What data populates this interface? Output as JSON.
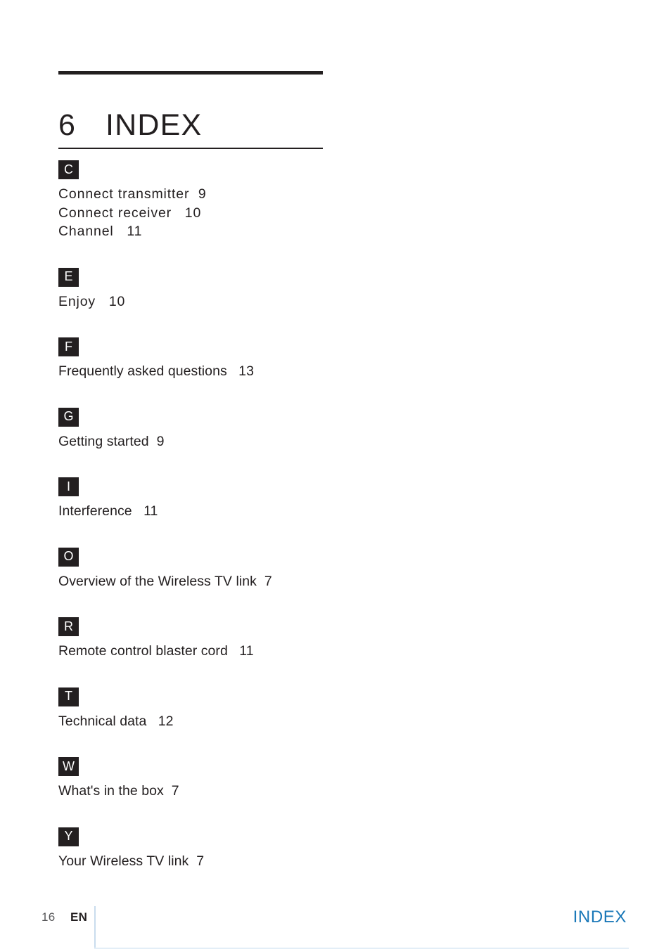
{
  "page": {
    "background_color": "#ffffff",
    "text_color": "#231f20"
  },
  "header": {
    "chapter_number": "6",
    "chapter_title": "INDEX"
  },
  "index": {
    "sections": [
      {
        "letter": "C",
        "entries": [
          {
            "term": "Connect transmitter",
            "page": "9",
            "text": "Connect transmitter  9"
          },
          {
            "term": "Connect receiver",
            "page": "10",
            "text": "Connect receiver   10"
          },
          {
            "term": "Channel",
            "page": "11",
            "text": "Channel   11"
          }
        ]
      },
      {
        "letter": "E",
        "entries": [
          {
            "term": "Enjoy",
            "page": "10",
            "text": "Enjoy   10"
          }
        ]
      },
      {
        "letter": "F",
        "entries": [
          {
            "term": "Frequently asked questions",
            "page": "13",
            "text": "Frequently asked questions   13"
          }
        ]
      },
      {
        "letter": "G",
        "entries": [
          {
            "term": "Getting started",
            "page": "9",
            "text": "Getting started  9"
          }
        ]
      },
      {
        "letter": "I",
        "entries": [
          {
            "term": "Interference",
            "page": "11",
            "text": "Interference   11"
          }
        ]
      },
      {
        "letter": "O",
        "entries": [
          {
            "term": "Overview of the Wireless TV link",
            "page": "7",
            "text": "Overview of the Wireless TV link  7"
          }
        ]
      },
      {
        "letter": "R",
        "entries": [
          {
            "term": "Remote control blaster cord",
            "page": "11",
            "text": "Remote control blaster cord   11"
          }
        ]
      },
      {
        "letter": "T",
        "entries": [
          {
            "term": "Technical data",
            "page": "12",
            "text": "Technical data   12"
          }
        ]
      },
      {
        "letter": "W",
        "entries": [
          {
            "term": "What's in the box",
            "page": "7",
            "text": "What's in the box  7"
          }
        ]
      },
      {
        "letter": "Y",
        "entries": [
          {
            "term": "Your Wireless TV link",
            "page": "7",
            "text": "Your Wireless TV link  7"
          }
        ]
      }
    ]
  },
  "footer": {
    "page_number": "16",
    "language": "EN",
    "chapter_label": "INDEX",
    "accent_color": "#1a78b8",
    "divider_color": "#c9dced"
  }
}
